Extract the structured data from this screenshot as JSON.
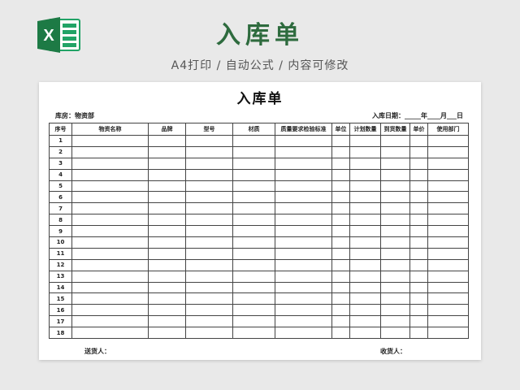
{
  "header": {
    "title": "入库单",
    "subtitle": "A4打印 / 自动公式 / 内容可修改",
    "logo_letter": "X"
  },
  "brand_color": "#2e6b3e",
  "sheet": {
    "title": "入库单",
    "warehouse_label": "库房：物资部",
    "date_label": "入库日期：_____年____月___日",
    "columns": [
      "序号",
      "物资名称",
      "品牌",
      "型号",
      "材质",
      "质量要求检验标准",
      "单位",
      "计划数量",
      "到货数量",
      "单价",
      "使用部门"
    ],
    "row_numbers": [
      "1",
      "2",
      "3",
      "4",
      "5",
      "6",
      "7",
      "8",
      "9",
      "10",
      "11",
      "12",
      "13",
      "14",
      "15",
      "16",
      "17",
      "18"
    ],
    "deliverer_label": "送货人：",
    "receiver_label": "收货人："
  }
}
